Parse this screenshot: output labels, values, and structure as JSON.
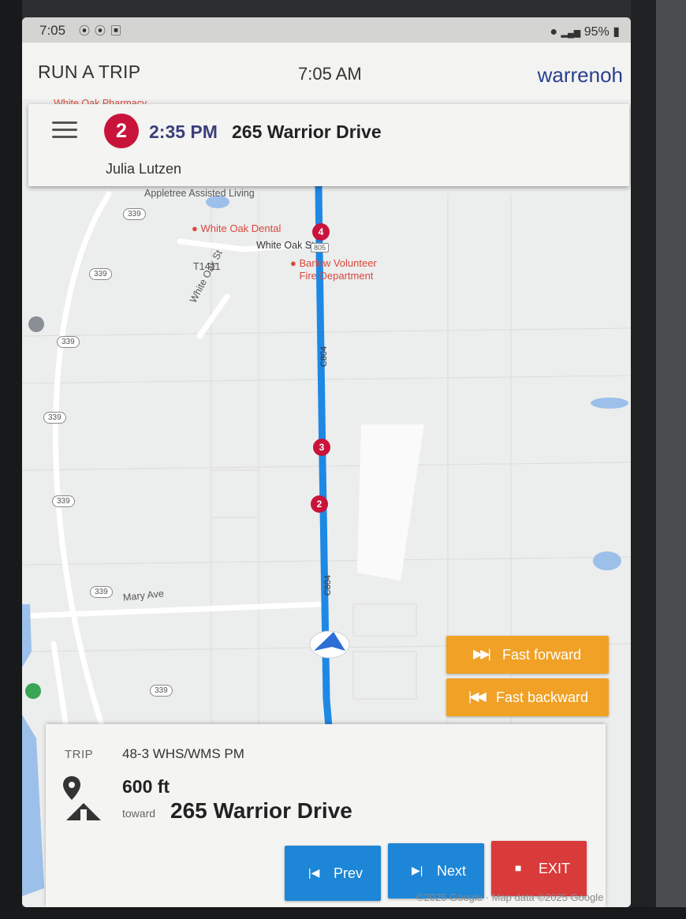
{
  "status_bar": {
    "time": "7:05",
    "left_icons": [
      "location-icon",
      "location-icon",
      "app-icon"
    ],
    "battery": "95%",
    "signal": "4G LTE"
  },
  "app_bar": {
    "title": "RUN A TRIP",
    "clock": "7:05 AM",
    "user": "warrenoh"
  },
  "stop_card": {
    "number": "2",
    "time": "2:35 PM",
    "address": "265 Warrior Drive",
    "passenger": "Julia Lutzen"
  },
  "map": {
    "labels": {
      "pharmacy": "White Oak Pharmacy",
      "assisted_living": "Appletree Assisted Living",
      "dental": "White Oak Dental",
      "white_oak_st": "White Oak St",
      "route_805": "805",
      "t1411": "T1411",
      "fire_dept_1": "Barlow Volunteer",
      "fire_dept_2": "Fire Department",
      "white_oak_st_vertical": "White Oak St",
      "c804_top": "C804",
      "c804_bottom": "C804",
      "mary_ave": "Mary Ave"
    },
    "route_shields": [
      "339",
      "339",
      "339",
      "339",
      "339",
      "339",
      "339"
    ],
    "stop_markers": [
      "4",
      "3",
      "2"
    ],
    "copyright": "©2025 Google · Map data ©2025 Google"
  },
  "buttons": {
    "fast_forward": "Fast forward",
    "fast_backward": "Fast backward",
    "prev": "Prev",
    "next": "Next",
    "exit": "EXIT"
  },
  "trip_panel": {
    "trip_key": "TRIP",
    "trip_value": "48-3 WHS/WMS PM",
    "distance": "600 ft",
    "toward_label": "toward",
    "destination": "265 Warrior Drive"
  },
  "colors": {
    "route_blue": "#1e88e5",
    "marker_red": "#c8143b",
    "fast_button": "#f0a126",
    "nav_button": "#1d86d6",
    "exit_button": "#d93a3a",
    "username": "#2a3f8f"
  }
}
